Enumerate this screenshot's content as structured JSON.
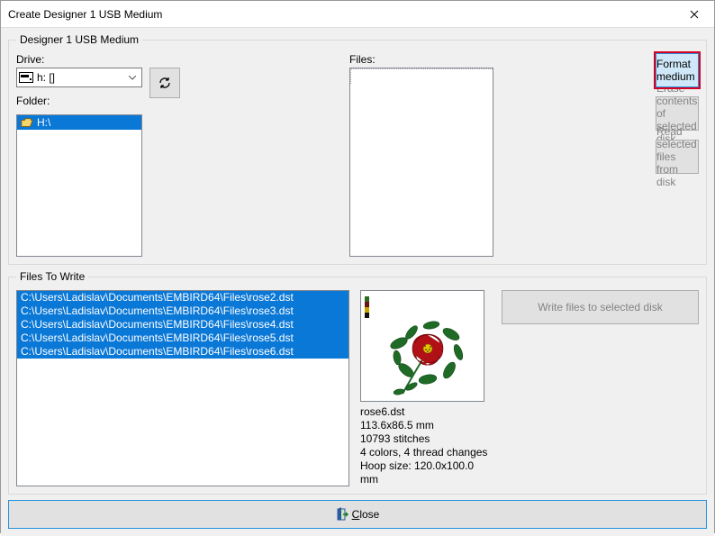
{
  "window": {
    "title": "Create Designer 1 USB Medium"
  },
  "group1": {
    "legend": "Designer 1 USB Medium",
    "drive_label": "Drive:",
    "drive_value": "h: []",
    "folder_label": "Folder:",
    "folder_item": "H:\\",
    "files_label": "Files:",
    "buttons": {
      "format": "Format medium",
      "erase": "Erase contents of selected disk",
      "read": "Read selected files from disk"
    }
  },
  "group2": {
    "legend": "Files To Write",
    "files": [
      "C:\\Users\\Ladislav\\Documents\\EMBIRD64\\Files\\rose2.dst",
      "C:\\Users\\Ladislav\\Documents\\EMBIRD64\\Files\\rose3.dst",
      "C:\\Users\\Ladislav\\Documents\\EMBIRD64\\Files\\rose4.dst",
      "C:\\Users\\Ladislav\\Documents\\EMBIRD64\\Files\\rose5.dst",
      "C:\\Users\\Ladislav\\Documents\\EMBIRD64\\Files\\rose6.dst"
    ],
    "preview": {
      "filename": "rose6.dst",
      "dimensions": "113.6x86.5 mm",
      "stitches": "10793 stitches",
      "colors": "4 colors, 4 thread changes",
      "hoop": "Hoop size: 120.0x100.0 mm",
      "palette": [
        "#2c6b1f",
        "#6f1414",
        "#c7a600",
        "#111111"
      ]
    },
    "write_button": "Write files to selected disk"
  },
  "close_label": "Close"
}
